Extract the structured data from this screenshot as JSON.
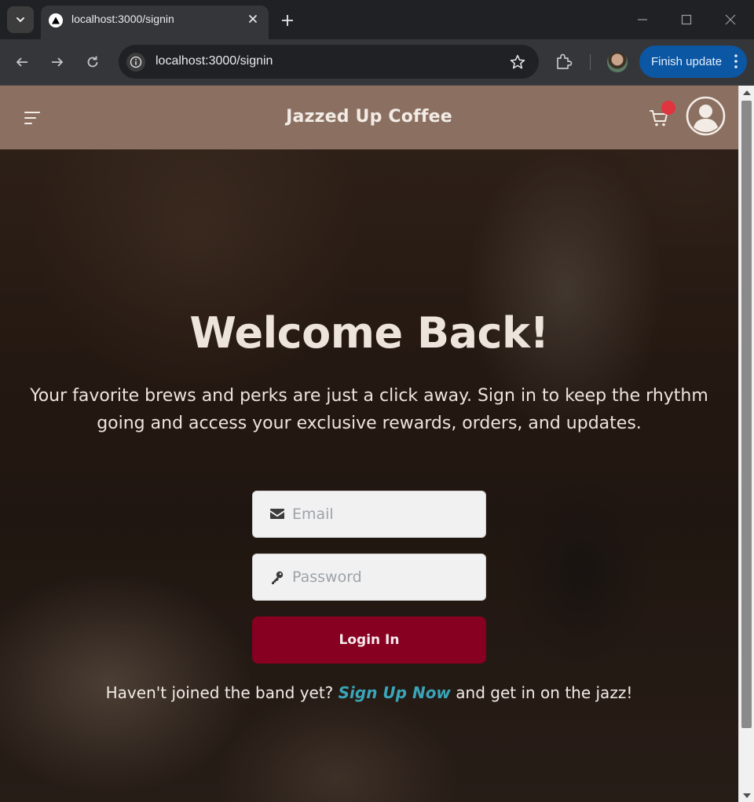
{
  "browser": {
    "tab": {
      "title": "localhost:3000/signin"
    },
    "address_bar": {
      "url": "localhost:3000/signin"
    },
    "finish_update_label": "Finish update"
  },
  "site": {
    "title": "Jazzed Up Coffee"
  },
  "hero": {
    "heading": "Welcome Back!",
    "subtitle": "Your favorite brews and perks are just a click away. Sign in to keep the rhythm going and access your exclusive rewards, orders, and updates."
  },
  "form": {
    "email_placeholder": "Email",
    "password_placeholder": "Password",
    "login_label": "Login In"
  },
  "signup": {
    "prefix": "Haven't joined the band yet?",
    "link": "Sign Up Now",
    "suffix": "and get in on the jazz!"
  },
  "colors": {
    "header_bg": "#8b7062",
    "login_button": "#870022",
    "signup_link": "#3aa5b8",
    "cart_badge": "#e0343f",
    "finish_update_bg": "#0b57a3"
  }
}
